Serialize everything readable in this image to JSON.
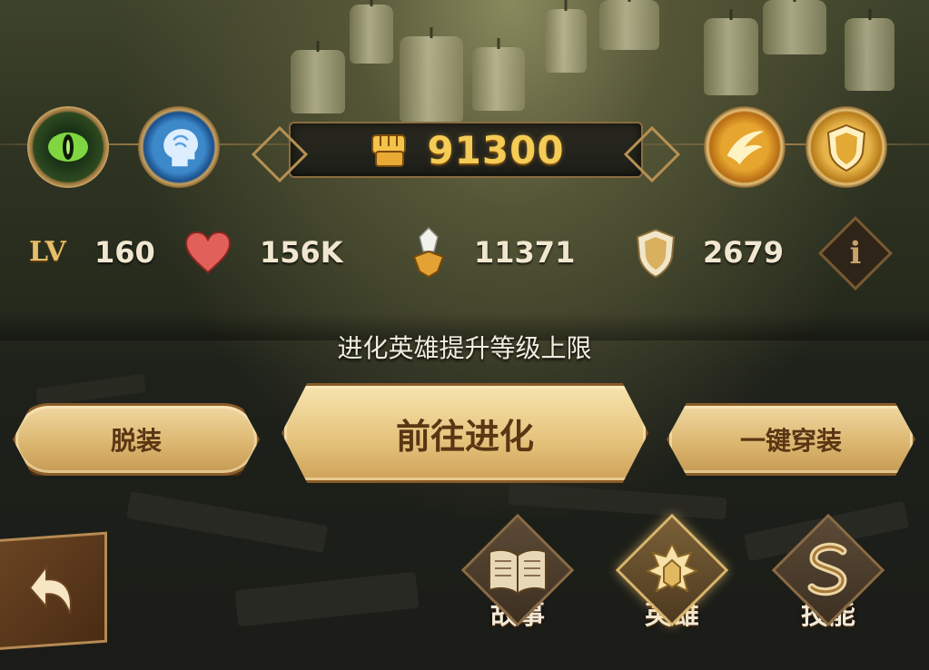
{
  "header": {
    "power_value": "91300",
    "icons": {
      "left_1": "green-eye-emblem-icon",
      "left_2": "blue-mind-head-icon",
      "power": "golden-fist-icon",
      "right_1": "golden-wing-icon",
      "right_2": "golden-shield-icon"
    }
  },
  "stats": {
    "level_label": "LV",
    "level": "160",
    "hp": "156K",
    "attack": "11371",
    "defense": "2679",
    "info_label": "i"
  },
  "hint": "进化英雄提升等级上限",
  "buttons": {
    "unequip": "脱装",
    "evolve": "前往进化",
    "equip_all": "一键穿装"
  },
  "tabs": [
    {
      "label": "故事",
      "icon": "open-book-icon",
      "active": false
    },
    {
      "label": "英雄",
      "icon": "hero-crest-icon",
      "active": true
    },
    {
      "label": "技能",
      "icon": "skill-s-scroll-icon",
      "active": false
    }
  ],
  "colors": {
    "gold": "#f4cc56",
    "button_face": "#dcb770",
    "button_text": "#5a3614"
  }
}
